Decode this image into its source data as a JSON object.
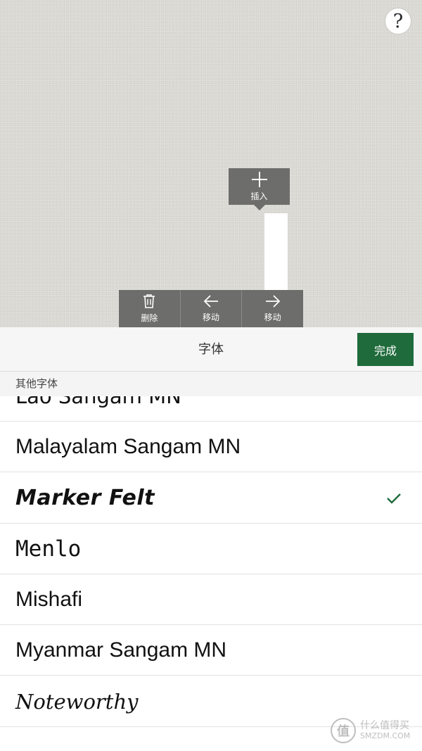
{
  "canvas": {
    "help_label": "?",
    "insert_label": "插入",
    "toolbar": {
      "delete_label": "删除",
      "move_left_label": "移动",
      "move_right_label": "移动"
    }
  },
  "panel": {
    "title": "字体",
    "done_label": "完成",
    "section_label": "其他字体"
  },
  "fonts": [
    {
      "name": "Lao Sangam MN",
      "selected": false
    },
    {
      "name": "Malayalam Sangam MN",
      "selected": false
    },
    {
      "name": "Marker Felt",
      "selected": true
    },
    {
      "name": "Menlo",
      "selected": false
    },
    {
      "name": "Mishafi",
      "selected": false
    },
    {
      "name": "Myanmar Sangam MN",
      "selected": false
    },
    {
      "name": "Noteworthy",
      "selected": false
    }
  ],
  "watermark": {
    "badge": "值",
    "cn": "什么值得买",
    "en": "SMZDM.COM"
  },
  "colors": {
    "accent": "#1f6b3b",
    "toolbar": "#6d6d6b",
    "canvas": "#dcdbd6"
  }
}
